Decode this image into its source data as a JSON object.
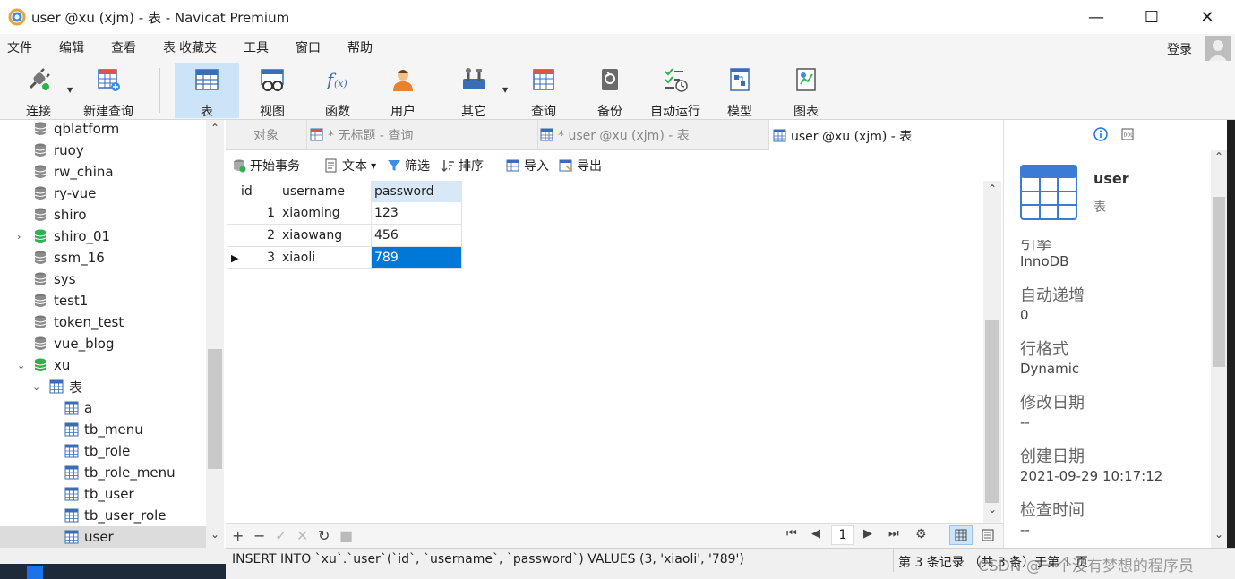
{
  "window": {
    "title": "user @xu (xjm) - 表 - Navicat Premium",
    "controls": [
      "—",
      "☐",
      "✕"
    ]
  },
  "menu": {
    "items": [
      "文件",
      "编辑",
      "查看",
      "表",
      "收藏夹",
      "工具",
      "窗口",
      "帮助"
    ],
    "login": "登录"
  },
  "toolbar": {
    "items": [
      {
        "label": "连接",
        "icon": "plug-icon"
      },
      {
        "label": "新建查询",
        "icon": "new-query-icon"
      },
      {
        "label": "表",
        "icon": "table-icon",
        "active": true
      },
      {
        "label": "视图",
        "icon": "view-icon"
      },
      {
        "label": "函数",
        "icon": "function-icon"
      },
      {
        "label": "用户",
        "icon": "user-icon"
      },
      {
        "label": "其它",
        "icon": "tools-icon"
      },
      {
        "label": "查询",
        "icon": "query-icon"
      },
      {
        "label": "备份",
        "icon": "backup-icon"
      },
      {
        "label": "自动运行",
        "icon": "schedule-icon"
      },
      {
        "label": "模型",
        "icon": "model-icon"
      },
      {
        "label": "图表",
        "icon": "chart-icon"
      }
    ]
  },
  "tree": {
    "items": [
      {
        "label": "qblatform",
        "type": "db"
      },
      {
        "label": "ruoy",
        "type": "db"
      },
      {
        "label": "rw_china",
        "type": "db"
      },
      {
        "label": "ry-vue",
        "type": "db"
      },
      {
        "label": "shiro",
        "type": "db"
      },
      {
        "label": "shiro_01",
        "type": "db-open",
        "expander": "›"
      },
      {
        "label": "ssm_16",
        "type": "db"
      },
      {
        "label": "sys",
        "type": "db"
      },
      {
        "label": "test1",
        "type": "db"
      },
      {
        "label": "token_test",
        "type": "db"
      },
      {
        "label": "vue_blog",
        "type": "db"
      },
      {
        "label": "xu",
        "type": "db-open",
        "expander": "⌄"
      },
      {
        "label": "表",
        "type": "folder",
        "expander": "⌄"
      },
      {
        "label": "a",
        "type": "table"
      },
      {
        "label": "tb_menu",
        "type": "table"
      },
      {
        "label": "tb_role",
        "type": "table"
      },
      {
        "label": "tb_role_menu",
        "type": "table"
      },
      {
        "label": "tb_user",
        "type": "table"
      },
      {
        "label": "tb_user_role",
        "type": "table"
      },
      {
        "label": "user",
        "type": "table",
        "selected": true
      }
    ]
  },
  "tabs": [
    {
      "label": "对象"
    },
    {
      "label": "* 无标题 - 查询"
    },
    {
      "label": "* user @xu (xjm) - 表"
    },
    {
      "label": "user @xu (xjm) - 表",
      "active": true
    }
  ],
  "actions": {
    "begin_tx": "开始事务",
    "text": "文本",
    "filter": "筛选",
    "sort": "排序",
    "import": "导入",
    "export": "导出"
  },
  "grid": {
    "columns": [
      "id",
      "username",
      "password"
    ],
    "rows": [
      [
        "1",
        "xiaoming",
        "123"
      ],
      [
        "2",
        "xiaowang",
        "456"
      ],
      [
        "3",
        "xiaoli",
        "789"
      ]
    ],
    "current_row": 2
  },
  "pager": {
    "page": "1"
  },
  "status": {
    "sql": "INSERT INTO `xu`.`user`(`id`, `username`, `password`) VALUES (3, 'xiaoli', '789')",
    "records": "第 3 条记录 （共 3 条）于第 1 页",
    "watermark": "CSDN @一个没有梦想的程序员"
  },
  "info": {
    "name": "user",
    "type": "表",
    "fields": [
      {
        "label": "引擎",
        "value": "InnoDB"
      },
      {
        "label": "自动递增",
        "value": "0"
      },
      {
        "label": "行格式",
        "value": "Dynamic"
      },
      {
        "label": "修改日期",
        "value": "--"
      },
      {
        "label": "创建日期",
        "value": "2021-09-29 10:17:12"
      },
      {
        "label": "检查时间",
        "value": "--"
      }
    ]
  },
  "colors": {
    "accent": "#0078d7",
    "toolbar_active": "#cde3f7",
    "db_green": "#2bb24c"
  }
}
